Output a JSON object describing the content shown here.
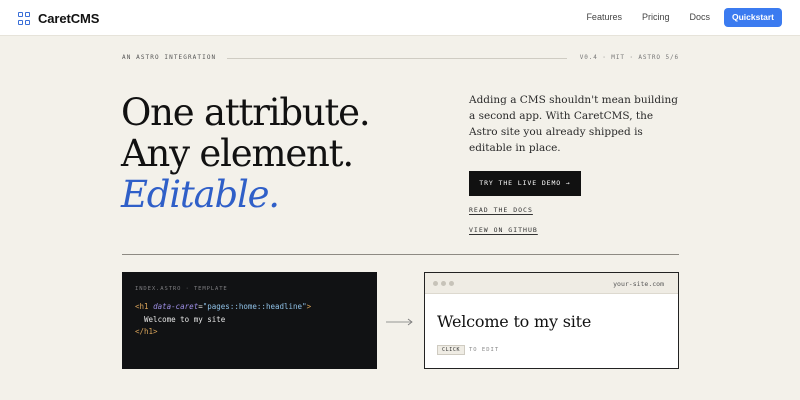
{
  "nav": {
    "brand": "CaretCMS",
    "links": [
      "Features",
      "Pricing",
      "Docs"
    ],
    "cta": "Quickstart"
  },
  "eyebrow": {
    "left": "AN ASTRO INTEGRATION",
    "right": "V0.4 · MIT · ASTRO 5/6"
  },
  "hero": {
    "line1": "One attribute.",
    "line2": "Any element.",
    "line3": "Editable.",
    "lede": "Adding a CMS shouldn't mean building a second app. With CaretCMS, the Astro site you already shipped is editable in place.",
    "demo_button": "TRY THE LIVE DEMO →",
    "docs_link": "READ THE DOCS",
    "github_link": "VIEW ON GITHUB"
  },
  "code_panel": {
    "label": "INDEX.ASTRO · TEMPLATE",
    "open_tag": "<h1",
    "attr": "data-caret",
    "eq": "=",
    "attr_value": "\"pages::home::headline\"",
    "open_tag_end": ">",
    "content": "Welcome to my site",
    "close_tag": "</h1>"
  },
  "browser": {
    "url": "your-site.com",
    "title": "Welcome to my site",
    "click_chip": "CLICK",
    "click_hint": "TO EDIT"
  },
  "colors": {
    "accent": "#2f5fc8",
    "cta": "#3b7bf0",
    "background": "#f3f1ea",
    "code_bg": "#111214"
  }
}
